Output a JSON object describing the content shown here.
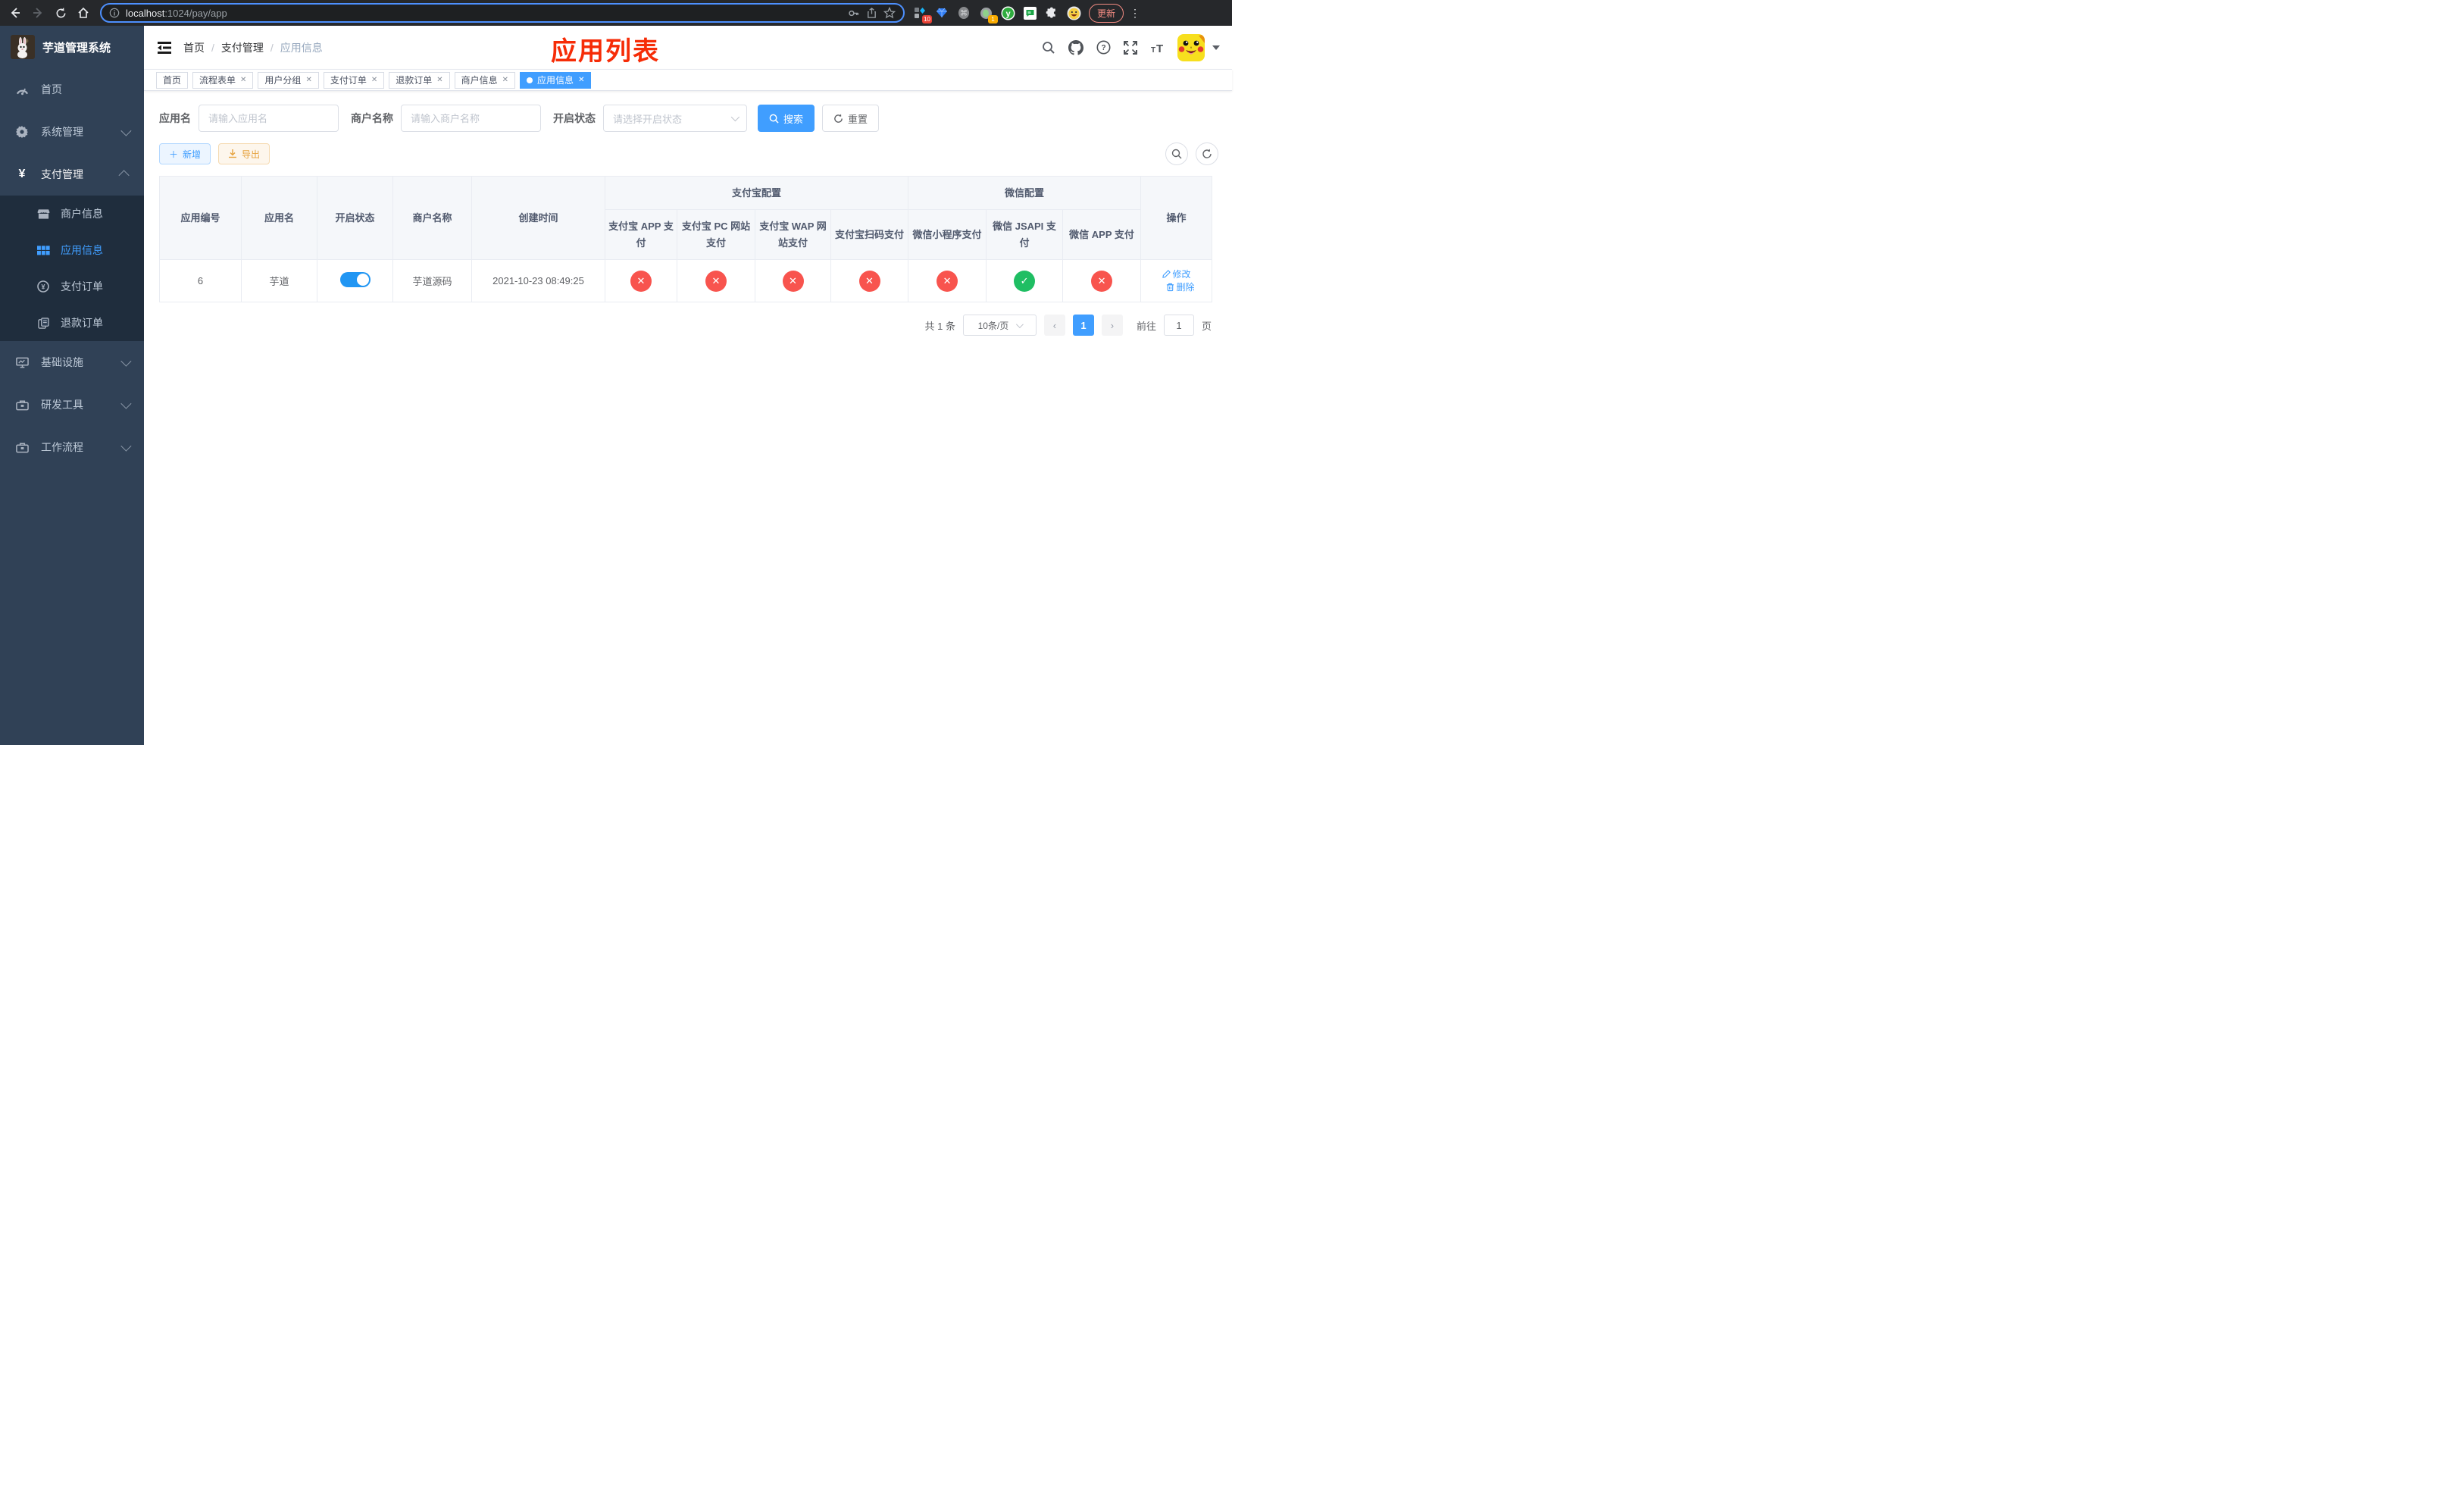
{
  "browser": {
    "url_host": "localhost",
    "url_path": ":1024/pay/app",
    "update_label": "更新",
    "extension_badge_count": "10",
    "notification_badge_count": "1"
  },
  "sidebar": {
    "title": "芋道管理系统",
    "items": [
      {
        "label": "首页",
        "icon": "dashboard-icon"
      },
      {
        "label": "系统管理",
        "icon": "gear-icon",
        "state": "collapsed"
      },
      {
        "label": "支付管理",
        "icon": "yen-icon",
        "state": "expanded"
      },
      {
        "label": "基础设施",
        "icon": "monitor-icon",
        "state": "collapsed"
      },
      {
        "label": "研发工具",
        "icon": "toolbox-icon",
        "state": "collapsed"
      },
      {
        "label": "工作流程",
        "icon": "toolbox-icon",
        "state": "collapsed"
      }
    ],
    "pay_children": [
      {
        "label": "商户信息",
        "icon": "shop-icon",
        "active": false
      },
      {
        "label": "应用信息",
        "icon": "grid-icon",
        "active": true
      },
      {
        "label": "支付订单",
        "icon": "yen-circle-icon",
        "active": false
      },
      {
        "label": "退款订单",
        "icon": "document-icon",
        "active": false
      }
    ]
  },
  "navbar": {
    "breadcrumb": [
      "首页",
      "支付管理",
      "应用信息"
    ],
    "separator": "/"
  },
  "annotation": {
    "title": "应用列表",
    "color": "#f62c07"
  },
  "tabs": [
    {
      "label": "首页",
      "closable": false,
      "active": false
    },
    {
      "label": "流程表单",
      "closable": true,
      "active": false
    },
    {
      "label": "用户分组",
      "closable": true,
      "active": false
    },
    {
      "label": "支付订单",
      "closable": true,
      "active": false
    },
    {
      "label": "退款订单",
      "closable": true,
      "active": false
    },
    {
      "label": "商户信息",
      "closable": true,
      "active": false
    },
    {
      "label": "应用信息",
      "closable": true,
      "active": true
    }
  ],
  "filters": {
    "app_name_label": "应用名",
    "app_name_placeholder": "请输入应用名",
    "merchant_label": "商户名称",
    "merchant_placeholder": "请输入商户名称",
    "status_label": "开启状态",
    "status_placeholder": "请选择开启状态",
    "search_label": "搜索",
    "reset_label": "重置"
  },
  "toolbar": {
    "add_label": "新增",
    "export_label": "导出"
  },
  "table": {
    "columns": [
      "应用编号",
      "应用名",
      "开启状态",
      "商户名称",
      "创建时间"
    ],
    "groups": [
      {
        "label": "支付宝配置",
        "children": [
          "支付宝 APP 支付",
          "支付宝 PC 网站支付",
          "支付宝 WAP 网站支付",
          "支付宝扫码支付"
        ]
      },
      {
        "label": "微信配置",
        "children": [
          "微信小程序支付",
          "微信 JSAPI 支付",
          "微信 APP 支付"
        ]
      }
    ],
    "action_label": "操作",
    "check_glyph": "✓",
    "cross_glyph": "✕",
    "row": {
      "id": "6",
      "name": "芋道",
      "enabled": true,
      "merchant": "芋道源码",
      "created": "2021-10-23 08:49:25",
      "statuses": [
        false,
        false,
        false,
        false,
        false,
        true,
        false
      ],
      "edit_label": "修改",
      "delete_label": "删除"
    }
  },
  "pagination": {
    "total_label": "共 1 条",
    "page_size_label": "10条/页",
    "prev_glyph": "‹",
    "next_glyph": "›",
    "current_page": "1",
    "goto_label": "前往",
    "goto_value": "1",
    "page_unit": "页"
  },
  "colors": {
    "accent": "#409eff",
    "danger": "#f8544e",
    "success": "#1fbe63",
    "warning": "#e6a23c",
    "sidebar_bg": "#304156",
    "submenu_bg": "#1f2d3d",
    "annotation_red": "#f62c07"
  }
}
